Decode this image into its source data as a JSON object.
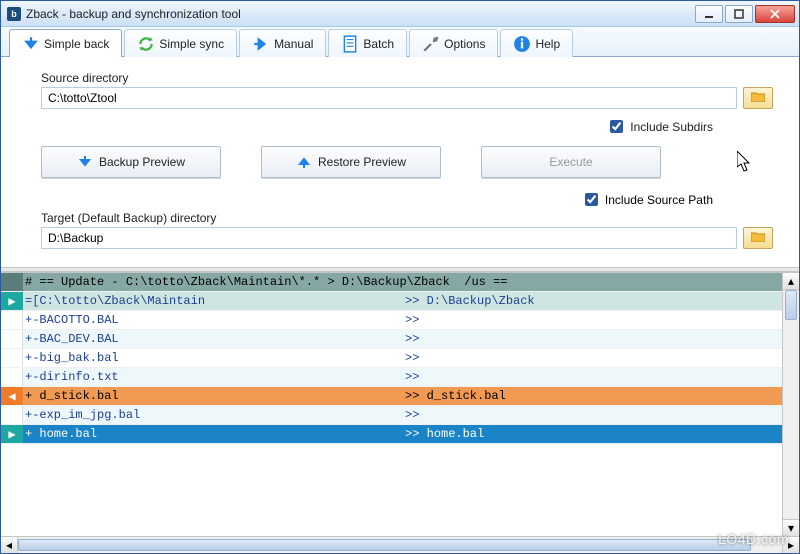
{
  "window": {
    "title": "Zback - backup and synchronization tool",
    "app_icon_letter": "b"
  },
  "tabs": [
    {
      "label": "Simple back",
      "active": true,
      "icon": "arrow-down-blue"
    },
    {
      "label": "Simple sync",
      "active": false,
      "icon": "sync-green"
    },
    {
      "label": "Manual",
      "active": false,
      "icon": "arrow-right-blue"
    },
    {
      "label": "Batch",
      "active": false,
      "icon": "document"
    },
    {
      "label": "Options",
      "active": false,
      "icon": "tools"
    },
    {
      "label": "Help",
      "active": false,
      "icon": "info"
    }
  ],
  "panel": {
    "source_label": "Source directory",
    "source_value": "C:\\totto\\Ztool",
    "include_subdirs_label": "Include Subdirs",
    "include_subdirs_checked": true,
    "backup_preview_label": "Backup Preview",
    "restore_preview_label": "Restore Preview",
    "execute_label": "Execute",
    "execute_enabled": false,
    "target_label": "Target (Default Backup) directory",
    "target_value": "D:\\Backup",
    "include_source_path_label": "Include Source Path",
    "include_source_path_checked": true
  },
  "log": {
    "rows": [
      {
        "gutter": "dark",
        "style": "header",
        "left": "# == Update - C:\\totto\\Zback\\Maintain\\*.* > D:\\Backup\\Zback  /us ==",
        "right": ""
      },
      {
        "gutter": "teal",
        "style": "section",
        "left": "=[C:\\totto\\Zback\\Maintain",
        "right": ">> D:\\Backup\\Zback"
      },
      {
        "gutter": "white",
        "style": "even",
        "left": "+-BACOTTO.BAL",
        "right": ">>"
      },
      {
        "gutter": "white",
        "style": "odd",
        "left": "+-BAC_DEV.BAL",
        "right": ">>"
      },
      {
        "gutter": "white",
        "style": "even",
        "left": "+-big_bak.bal",
        "right": ">>"
      },
      {
        "gutter": "white",
        "style": "odd",
        "left": "+-dirinfo.txt",
        "right": ">>"
      },
      {
        "gutter": "orange",
        "style": "orange",
        "left": "+ d_stick.bal",
        "right": ">> d_stick.bal"
      },
      {
        "gutter": "white",
        "style": "odd",
        "left": "+-exp_im_jpg.bal",
        "right": ">>"
      },
      {
        "gutter": "teal",
        "style": "selected",
        "left": "+ home.bal",
        "right": ">> home.bal"
      }
    ]
  },
  "watermark": "LO4D.com"
}
